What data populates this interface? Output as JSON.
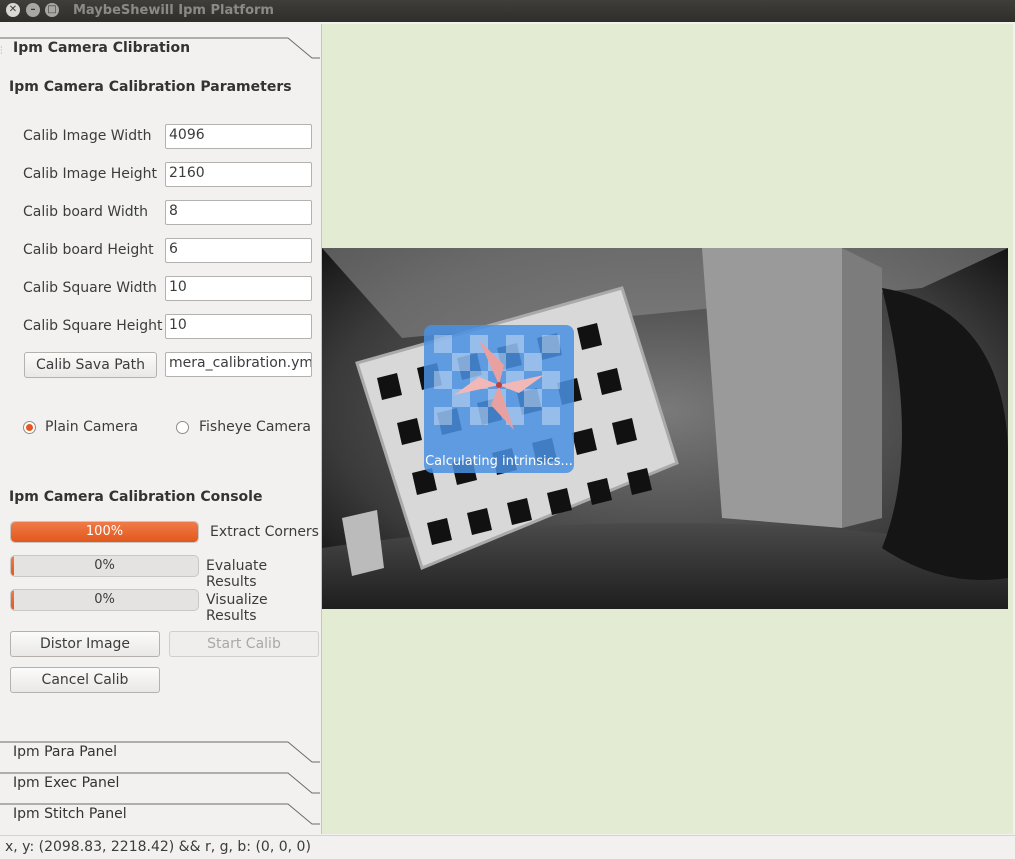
{
  "window": {
    "title": "MaybeShewill Ipm Platform"
  },
  "toolbox": {
    "active_tab": "Ipm Camera Clibration",
    "other_tabs": [
      "Ipm Para Panel",
      "Ipm Exec Panel",
      "Ipm Stitch Panel"
    ]
  },
  "params": {
    "title": "Ipm Camera Calibration Parameters",
    "fields": [
      {
        "label": "Calib Image Width",
        "value": "4096"
      },
      {
        "label": "Calib Image Height",
        "value": "2160"
      },
      {
        "label": "Calib board Width",
        "value": "8"
      },
      {
        "label": "Calib board Height",
        "value": "6"
      },
      {
        "label": "Calib Square Width",
        "value": "10"
      },
      {
        "label": "Calib Square Height",
        "value": "10"
      }
    ],
    "save_path_button": "Calib Sava Path",
    "save_path_value": "mera_calibration.yml"
  },
  "camera_type": {
    "options": [
      {
        "label": "Plain Camera",
        "checked": true
      },
      {
        "label": "Fisheye Camera",
        "checked": false
      }
    ]
  },
  "console": {
    "title": "Ipm Camera Calibration Console",
    "progress": [
      {
        "label": "Extract Corners",
        "value": 100,
        "text": "100%"
      },
      {
        "label": "Evaluate Results",
        "value": 0,
        "text": "0%"
      },
      {
        "label": "Visualize Results",
        "value": 0,
        "text": "0%"
      }
    ],
    "buttons": {
      "distort": "Distor Image",
      "start": "Start Calib",
      "cancel": "Cancel Calib"
    }
  },
  "view": {
    "overlay_text": "Calculating intrinsics...",
    "background_color": "#e3ecd3",
    "overlay_color": "#4a90e2",
    "accent_color": "#e2571c"
  },
  "statusbar": {
    "text": "x, y: (2098.83, 2218.42) && r, g, b: (0, 0, 0)"
  }
}
